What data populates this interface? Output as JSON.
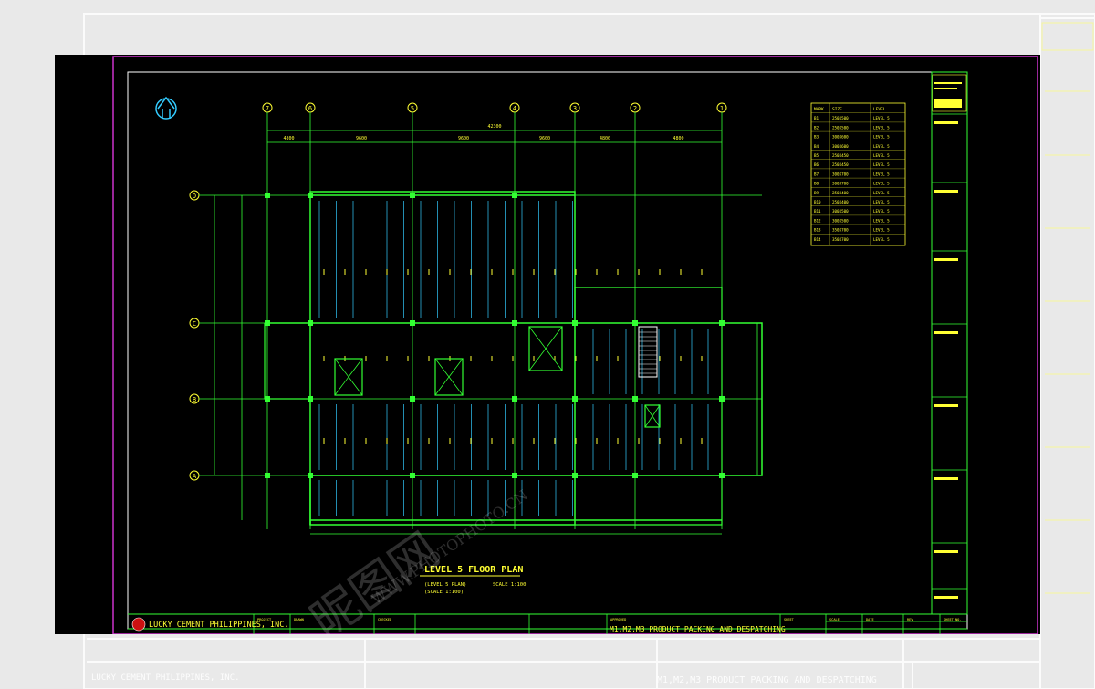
{
  "drawing": {
    "plan_title": "LEVEL 5 FLOOR PLAN",
    "plan_subtitle_1": "(LEVEL 5 PLAN)",
    "plan_subtitle_2": "(SCALE 1:100)",
    "scale_note": "SCALE 1:100",
    "company": "LUCKY CEMENT PHILIPPINES, INC.",
    "project": "M1,M2,M3 PRODUCT PACKING AND DESPATCHING",
    "grid_columns": [
      "7",
      "6",
      "5",
      "4",
      "3",
      "2",
      "1"
    ],
    "grid_rows": [
      "D",
      "C",
      "B",
      "A"
    ],
    "overall_dim": "42300",
    "bay_dims": [
      "4800",
      "9600",
      "9600",
      "9600",
      "4800",
      "4800"
    ],
    "accent_color": "#33ff33",
    "text_color": "#ffff33",
    "border_color": "#cc33cc",
    "rebar_color": "#33ccff"
  },
  "legend": {
    "headers": [
      "MARK",
      "SIZE",
      "LEVEL"
    ],
    "rows": [
      [
        "B1",
        "250X500",
        "LEVEL 5"
      ],
      [
        "B2",
        "250X500",
        "LEVEL 5"
      ],
      [
        "B3",
        "300X600",
        "LEVEL 5"
      ],
      [
        "B4",
        "300X600",
        "LEVEL 5"
      ],
      [
        "B5",
        "250X450",
        "LEVEL 5"
      ],
      [
        "B6",
        "250X450",
        "LEVEL 5"
      ],
      [
        "B7",
        "300X700",
        "LEVEL 5"
      ],
      [
        "B8",
        "300X700",
        "LEVEL 5"
      ],
      [
        "B9",
        "250X400",
        "LEVEL 5"
      ],
      [
        "B10",
        "250X400",
        "LEVEL 5"
      ],
      [
        "B11",
        "300X500",
        "LEVEL 5"
      ],
      [
        "B12",
        "300X500",
        "LEVEL 5"
      ],
      [
        "B13",
        "350X700",
        "LEVEL 5"
      ],
      [
        "B14",
        "350X700",
        "LEVEL 5"
      ]
    ]
  },
  "title_block": {
    "labels": [
      "PROJECT",
      "DRAWN",
      "CHECKED",
      "APPROVED",
      "SHEET",
      "SCALE",
      "DATE",
      "REV",
      "SHEET NO."
    ]
  },
  "watermark": {
    "text_cn": "昵图网",
    "text_url": "WWW.PHOTOPHOTO.CN"
  }
}
